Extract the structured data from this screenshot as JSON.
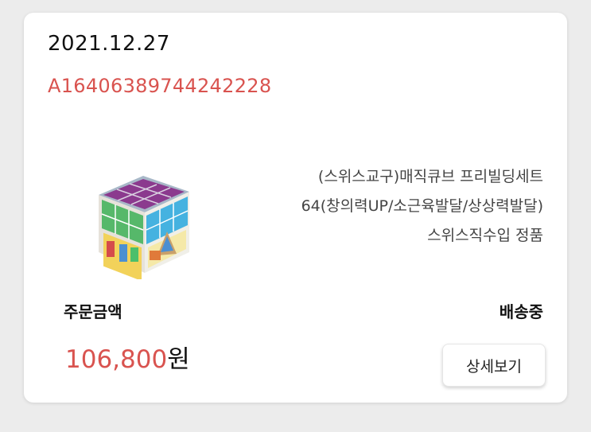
{
  "order": {
    "date": "2021.12.27",
    "number": "A16406389744242228"
  },
  "product": {
    "name_line1": "(스위스교구)매직큐브 프리빌딩세트",
    "name_line2": "64(창의력UP/소근육발달/상상력발달)",
    "name_line3": "스위스직수입 정품",
    "image_icon": "magic-cube-toy-icon"
  },
  "payment": {
    "amount_label": "주문금액",
    "amount_value": "106,800",
    "currency": "원"
  },
  "status": {
    "label": "배송중"
  },
  "actions": {
    "detail_button": "상세보기"
  },
  "colors": {
    "accent_red": "#d9534f",
    "text_dark": "#111111",
    "background": "#ececec",
    "card": "#ffffff"
  }
}
